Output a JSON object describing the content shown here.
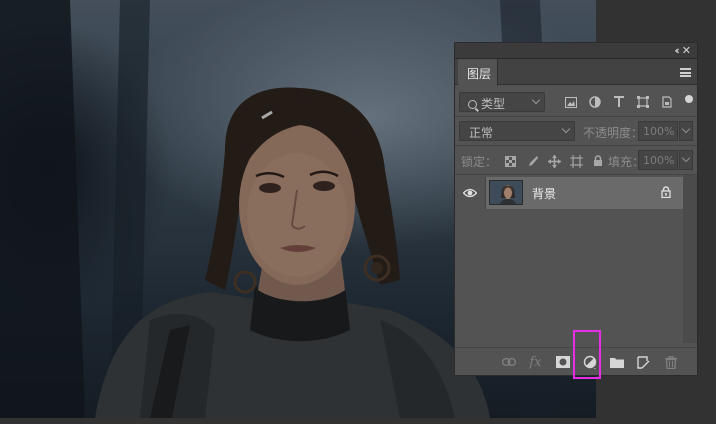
{
  "panel": {
    "tab_label": "图层",
    "collapse_glyph": "‹‹",
    "close_glyph": "✕"
  },
  "filter": {
    "kind_label": "类型",
    "icons": [
      "image-filter-icon",
      "adjustment-filter-icon",
      "type-filter-icon",
      "shape-filter-icon",
      "smart-object-filter-icon"
    ]
  },
  "blend": {
    "mode": "正常",
    "opacity_label": "不透明度：",
    "opacity_value": "100%"
  },
  "lock": {
    "label": "锁定：",
    "icons": [
      "lock-transparent-pixels-icon",
      "lock-image-pixels-icon",
      "lock-position-icon",
      "lock-artboard-icon",
      "lock-all-icon"
    ],
    "fill_label": "填充：",
    "fill_value": "100%"
  },
  "layers": [
    {
      "name": "背景",
      "visible": true,
      "locked": true
    }
  ],
  "bottom_toolbar": {
    "icons": [
      "link-layers-icon",
      "layer-style-fx-icon",
      "add-mask-icon",
      "new-adjustment-layer-icon",
      "new-group-icon",
      "new-layer-icon",
      "delete-layer-icon"
    ],
    "fx_text": "fx",
    "highlighted": "new-adjustment-layer-icon",
    "highlight_color": "#e62ee6"
  },
  "colors": {
    "panel_bg": "#535353",
    "workspace_bg": "#323232",
    "selected_layer_bg": "#6a6a6a"
  }
}
